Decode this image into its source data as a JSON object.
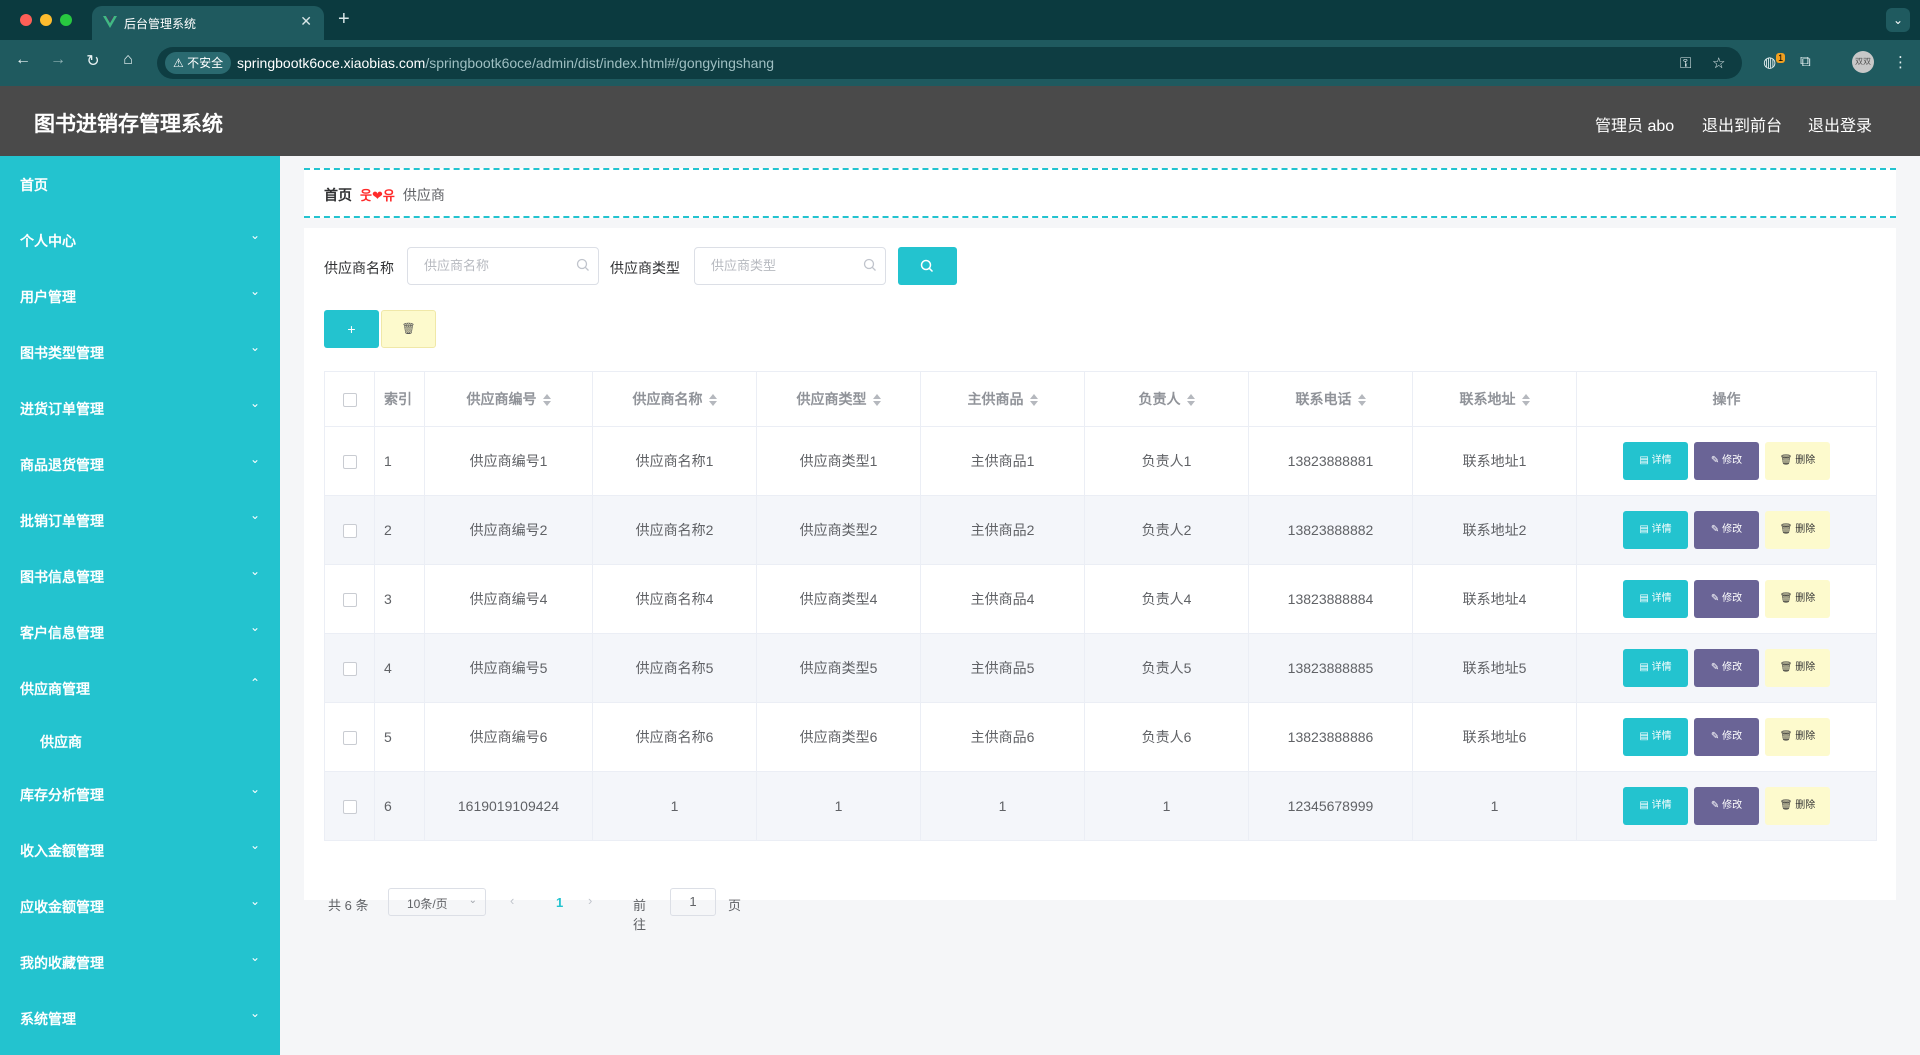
{
  "browser": {
    "tab_title": "后台管理系统",
    "new_tab": "+",
    "insecure_label": "不安全",
    "url_host": "springbootk6oce.xiaobias.com",
    "url_path": "/springbootk6oce/admin/dist/index.html#/gongyingshang",
    "profile_label": "双双",
    "extension_badge": "1"
  },
  "header": {
    "title": "图书进销存管理系统",
    "user": "管理员 abo",
    "to_front": "退出到前台",
    "logout": "退出登录"
  },
  "sidebar": {
    "items": [
      {
        "label": "首页"
      },
      {
        "label": "个人中心"
      },
      {
        "label": "用户管理"
      },
      {
        "label": "图书类型管理"
      },
      {
        "label": "进货订单管理"
      },
      {
        "label": "商品退货管理"
      },
      {
        "label": "批销订单管理"
      },
      {
        "label": "图书信息管理"
      },
      {
        "label": "客户信息管理"
      },
      {
        "label": "供应商管理"
      },
      {
        "label": "库存分析管理"
      },
      {
        "label": "收入金额管理"
      },
      {
        "label": "应收金额管理"
      },
      {
        "label": "我的收藏管理"
      },
      {
        "label": "系统管理"
      }
    ],
    "subitem": "供应商"
  },
  "breadcrumb": {
    "home": "首页",
    "separator": "웃❤유",
    "current": "供应商"
  },
  "filters": {
    "name_label": "供应商名称",
    "name_placeholder": "供应商名称",
    "type_label": "供应商类型",
    "type_placeholder": "供应商类型"
  },
  "actions": {
    "add": "+",
    "delete": "🗑"
  },
  "table": {
    "headers": [
      "索引",
      "供应商编号",
      "供应商名称",
      "供应商类型",
      "主供商品",
      "负责人",
      "联系电话",
      "联系地址",
      "操作"
    ],
    "rows": [
      [
        "1",
        "供应商编号1",
        "供应商名称1",
        "供应商类型1",
        "主供商品1",
        "负责人1",
        "13823888881",
        "联系地址1"
      ],
      [
        "2",
        "供应商编号2",
        "供应商名称2",
        "供应商类型2",
        "主供商品2",
        "负责人2",
        "13823888882",
        "联系地址2"
      ],
      [
        "3",
        "供应商编号4",
        "供应商名称4",
        "供应商类型4",
        "主供商品4",
        "负责人4",
        "13823888884",
        "联系地址4"
      ],
      [
        "4",
        "供应商编号5",
        "供应商名称5",
        "供应商类型5",
        "主供商品5",
        "负责人5",
        "13823888885",
        "联系地址5"
      ],
      [
        "5",
        "供应商编号6",
        "供应商名称6",
        "供应商类型6",
        "主供商品6",
        "负责人6",
        "13823888886",
        "联系地址6"
      ],
      [
        "6",
        "1619019109424",
        "1",
        "1",
        "1",
        "1",
        "12345678999",
        "1"
      ]
    ],
    "op_detail": "详情",
    "op_edit": "修改",
    "op_delete": "删除"
  },
  "pagination": {
    "total": "共 6 条",
    "page_size": "10条/页",
    "current_page": "1",
    "goto": "前往",
    "jump_value": "1",
    "page_unit": "页"
  },
  "colors": {
    "accent": "#23c3cf",
    "header_bg": "#4a4a4a",
    "edit_button": "#6a6496",
    "delete_button": "#fdfacd"
  }
}
